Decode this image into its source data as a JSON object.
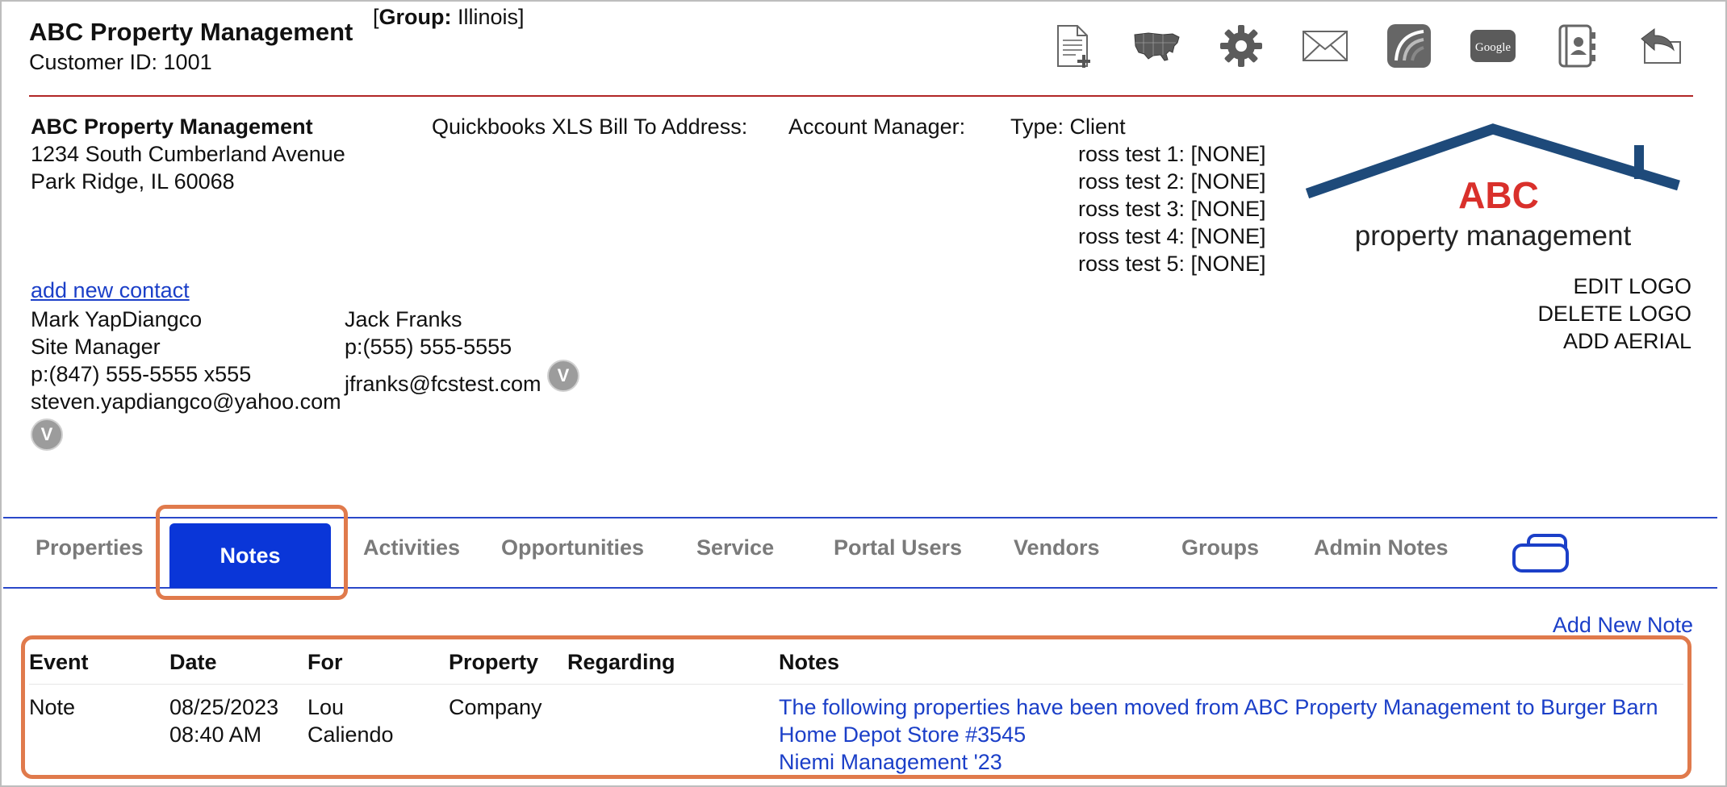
{
  "header": {
    "company_name": "ABC Property Management",
    "customer_id": "Customer ID: 1001",
    "group_prefix": "[",
    "group_label": "Group:",
    "group_value": " Illinois]"
  },
  "toolbar": {
    "icons": [
      "new-document-icon",
      "usa-map-icon",
      "gear-icon",
      "mail-icon",
      "app-logo-icon",
      "google-icon",
      "contacts-book-icon",
      "return-icon"
    ],
    "google_text": "Google"
  },
  "address": {
    "name": "ABC Property Management",
    "street": "1234 South Cumberland Avenue",
    "city": "Park Ridge,  IL 60068"
  },
  "billing": {
    "label": "Quickbooks XLS Bill To Address:"
  },
  "account_manager": {
    "label": "Account Manager:"
  },
  "type": {
    "label": "Type: Client",
    "fields": [
      "ross test 1: [NONE]",
      "ross test 2: [NONE]",
      "ross test 3: [NONE]",
      "ross test 4: [NONE]",
      "ross test 5: [NONE]"
    ]
  },
  "logo": {
    "brand_top": "ABC",
    "brand_bottom": "property management",
    "colors": {
      "roof": "#1e4a7a",
      "abc": "#d9302b",
      "text": "#222222"
    },
    "actions": [
      "EDIT LOGO",
      "DELETE LOGO",
      "ADD AERIAL"
    ]
  },
  "contacts": {
    "add_label": "add new contact",
    "list": [
      {
        "name": "Mark YapDiangco",
        "title": "Site Manager",
        "phone": "p:(847) 555-5555 x555",
        "email": "steven.yapdiangco@yahoo.com",
        "badge": "V"
      },
      {
        "name": "Jack Franks",
        "phone": "p:(555) 555-5555",
        "email": "jfranks@fcstest.com",
        "badge": "V"
      }
    ]
  },
  "tabs": {
    "items": [
      "Properties",
      "Notes",
      "Activities",
      "Opportunities",
      "Service",
      "Portal Users",
      "Vendors",
      "Groups",
      "Admin Notes"
    ],
    "active": "Notes",
    "colors": {
      "active_bg": "#0a36d8",
      "highlight": "#e07a4c"
    }
  },
  "notes": {
    "add_label": "Add New Note",
    "columns": [
      "Event",
      "Date",
      "For",
      "Property",
      "Regarding",
      "Notes"
    ],
    "rows": [
      {
        "event": "Note",
        "date": "08/25/2023",
        "time": "08:40 AM",
        "for_first": "Lou",
        "for_last": "Caliendo",
        "property": "Company",
        "regarding": "",
        "note_lines": [
          "The following properties have been moved from ABC Property Management to Burger Barn",
          "Home Depot Store #3545",
          "Niemi Management '23"
        ]
      }
    ]
  }
}
